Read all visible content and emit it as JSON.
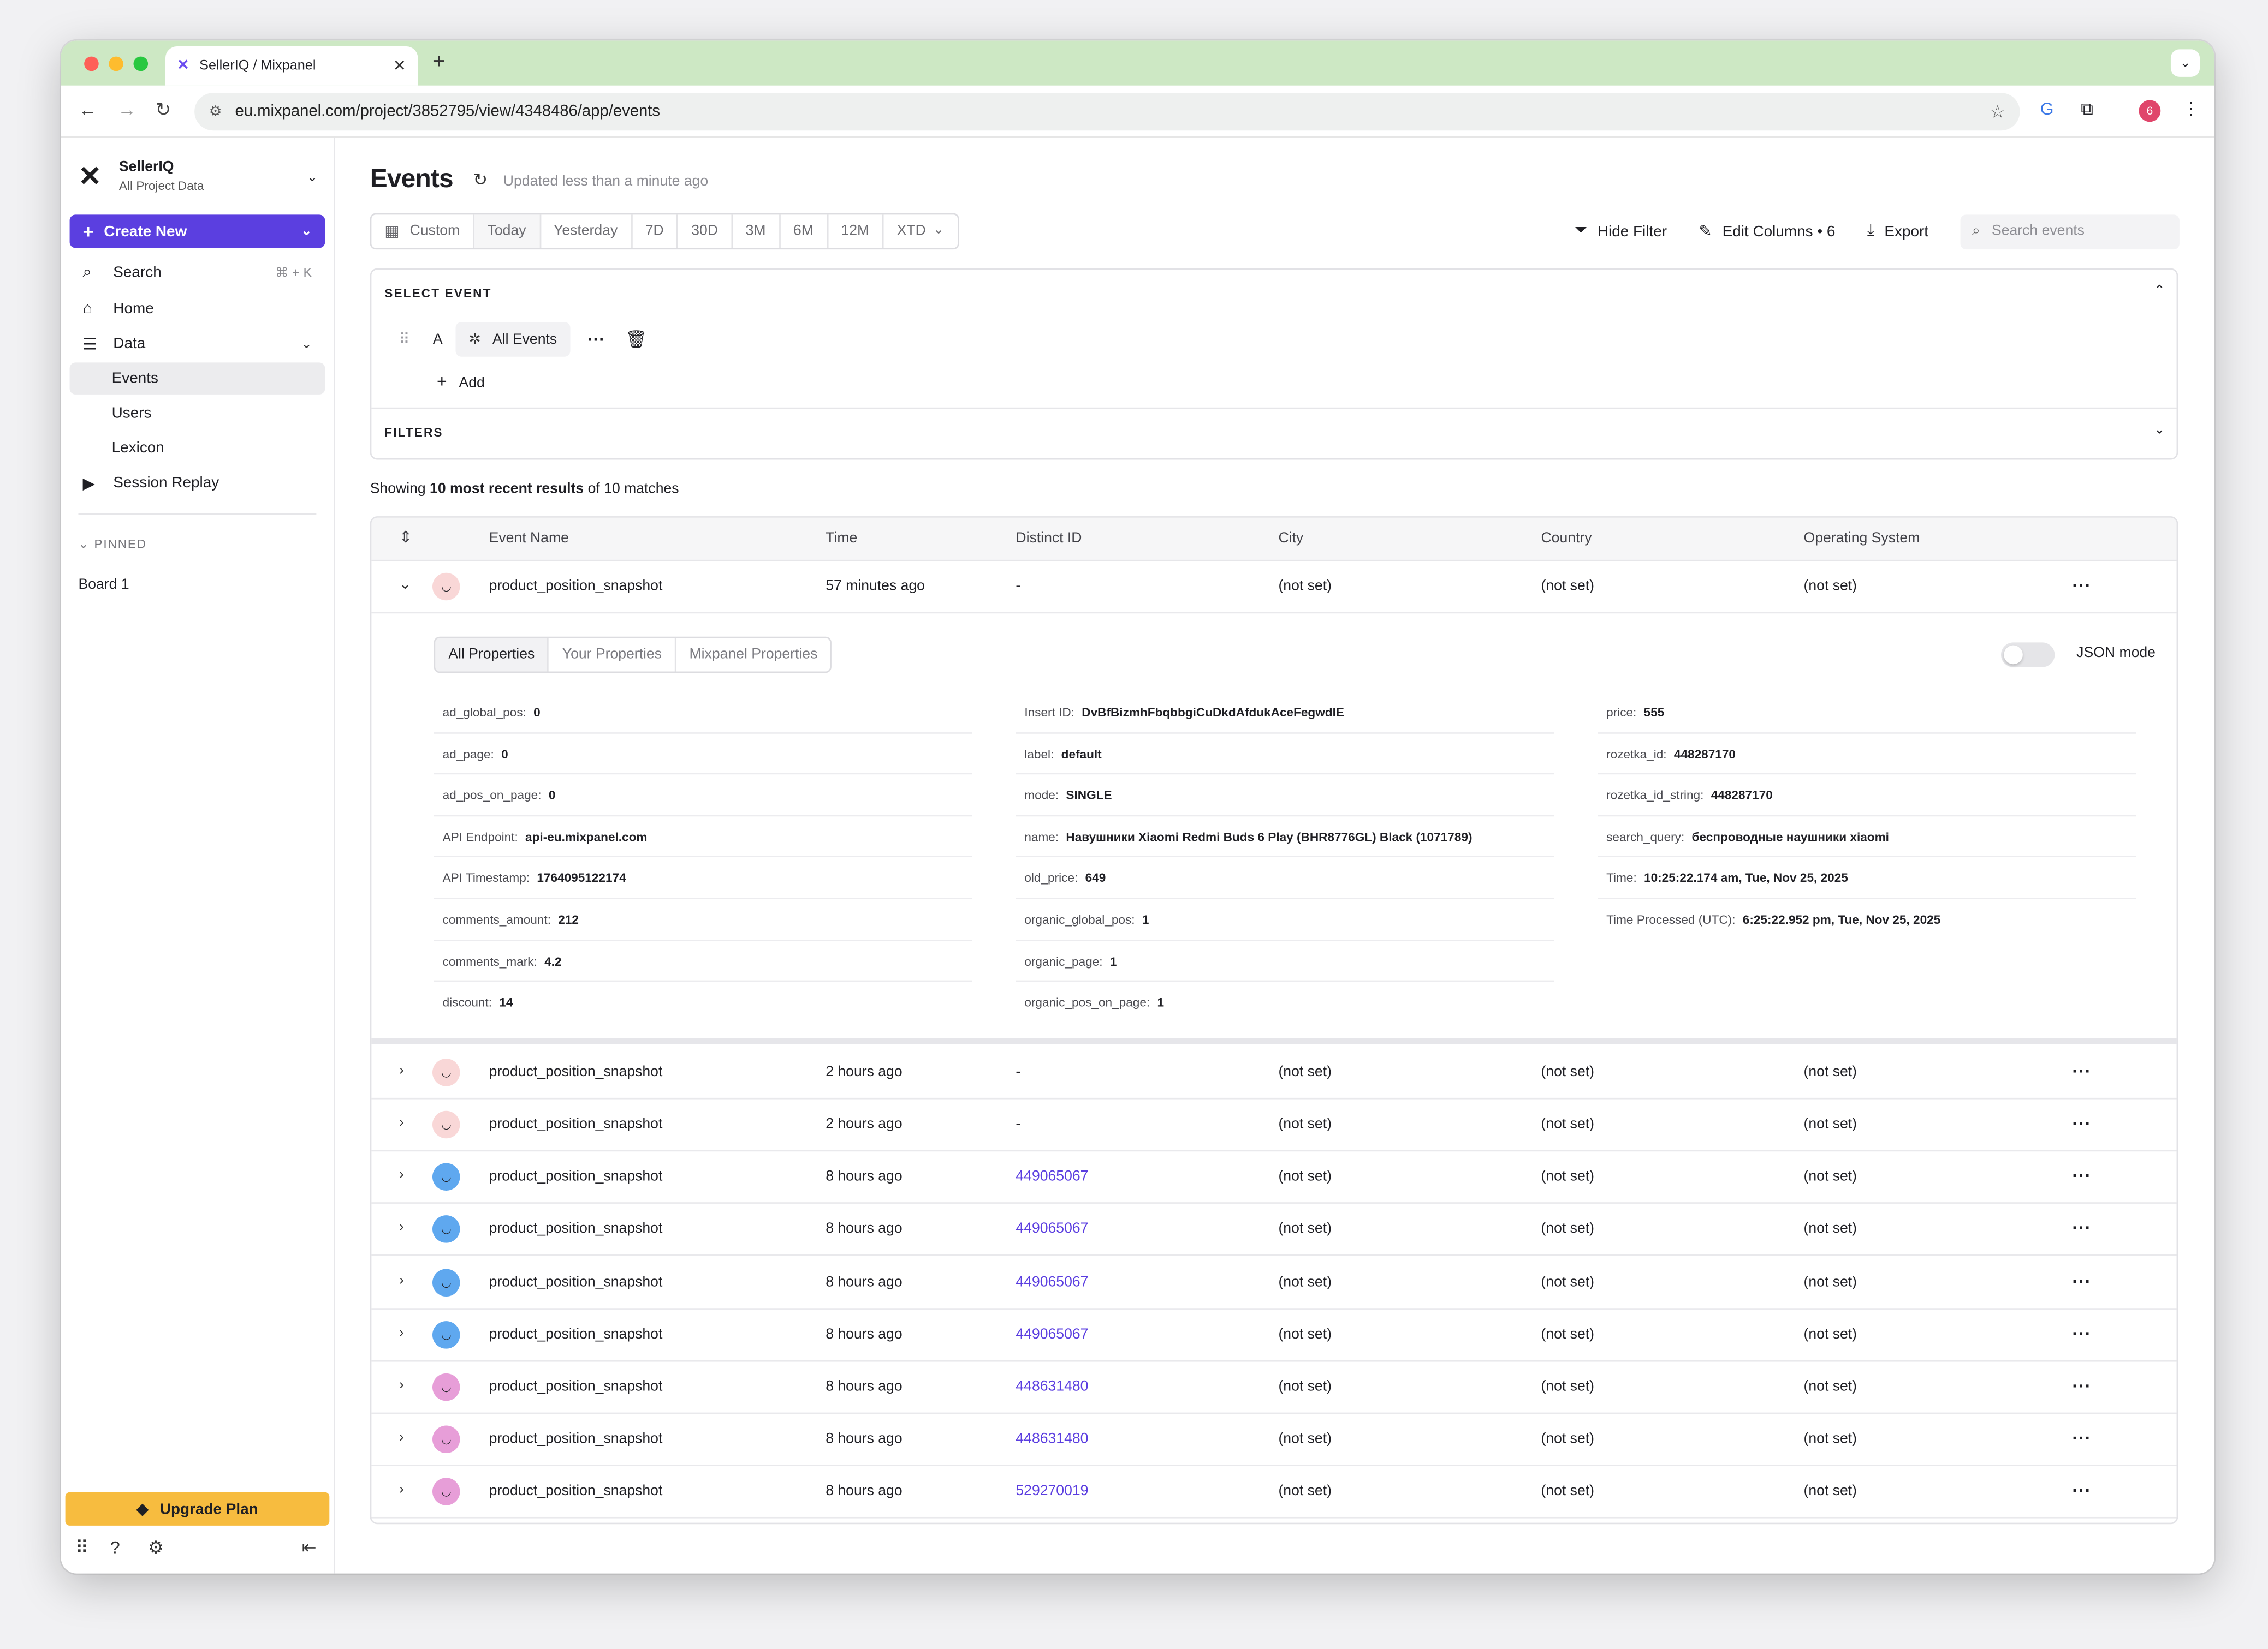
{
  "browser": {
    "tab_title": "SellerIQ / Mixpanel",
    "url": "eu.mixpanel.com/project/3852795/view/4348486/app/events",
    "profile_badge": "6"
  },
  "sidebar": {
    "workspace": {
      "name": "SellerIQ",
      "subtitle": "All Project Data"
    },
    "create_label": "Create New",
    "search": {
      "label": "Search",
      "shortcut": "⌘ + K"
    },
    "items": [
      {
        "label": "Home",
        "icon": "home-icon"
      },
      {
        "label": "Data",
        "icon": "database-icon"
      },
      {
        "label": "Events",
        "sub": true,
        "active": true
      },
      {
        "label": "Users",
        "sub": true
      },
      {
        "label": "Lexicon",
        "sub": true
      },
      {
        "label": "Session Replay",
        "icon": "replay-icon"
      }
    ],
    "pinned_label": "PINNED",
    "board_label": "Board 1",
    "upgrade_label": "Upgrade Plan"
  },
  "header": {
    "title": "Events",
    "updated": "Updated less than a minute ago"
  },
  "date_range": [
    "Custom",
    "Today",
    "Yesterday",
    "7D",
    "30D",
    "3M",
    "6M",
    "12M",
    "XTD"
  ],
  "date_range_active": "Today",
  "actions": {
    "hide_filter": "Hide Filter",
    "edit_columns": "Edit Columns • 6",
    "export": "Export",
    "search_placeholder": "Search events"
  },
  "select_event": {
    "heading": "SELECT EVENT",
    "letter": "A",
    "event": "All Events",
    "add": "Add",
    "filters_heading": "FILTERS"
  },
  "results": {
    "prefix": "Showing ",
    "bold": "10 most recent results",
    "suffix": " of 10 matches"
  },
  "table": {
    "columns": [
      "Event Name",
      "Time",
      "Distinct ID",
      "City",
      "Country",
      "Operating System"
    ],
    "rows": [
      {
        "event": "product_position_snapshot",
        "time": "57 minutes ago",
        "distinct_id": "-",
        "city": "(not set)",
        "country": "(not set)",
        "os": "(not set)",
        "avatar": "#f9d7d7"
      },
      {
        "event": "product_position_snapshot",
        "time": "2 hours ago",
        "distinct_id": "-",
        "city": "(not set)",
        "country": "(not set)",
        "os": "(not set)",
        "avatar": "#f9d7d7"
      },
      {
        "event": "product_position_snapshot",
        "time": "2 hours ago",
        "distinct_id": "-",
        "city": "(not set)",
        "country": "(not set)",
        "os": "(not set)",
        "avatar": "#f9d7d7"
      },
      {
        "event": "product_position_snapshot",
        "time": "8 hours ago",
        "distinct_id": "449065067",
        "city": "(not set)",
        "country": "(not set)",
        "os": "(not set)",
        "avatar": "#5fa8ef"
      },
      {
        "event": "product_position_snapshot",
        "time": "8 hours ago",
        "distinct_id": "449065067",
        "city": "(not set)",
        "country": "(not set)",
        "os": "(not set)",
        "avatar": "#5fa8ef"
      },
      {
        "event": "product_position_snapshot",
        "time": "8 hours ago",
        "distinct_id": "449065067",
        "city": "(not set)",
        "country": "(not set)",
        "os": "(not set)",
        "avatar": "#5fa8ef"
      },
      {
        "event": "product_position_snapshot",
        "time": "8 hours ago",
        "distinct_id": "449065067",
        "city": "(not set)",
        "country": "(not set)",
        "os": "(not set)",
        "avatar": "#5fa8ef"
      },
      {
        "event": "product_position_snapshot",
        "time": "8 hours ago",
        "distinct_id": "448631480",
        "city": "(not set)",
        "country": "(not set)",
        "os": "(not set)",
        "avatar": "#e79ed8"
      },
      {
        "event": "product_position_snapshot",
        "time": "8 hours ago",
        "distinct_id": "448631480",
        "city": "(not set)",
        "country": "(not set)",
        "os": "(not set)",
        "avatar": "#e79ed8"
      },
      {
        "event": "product_position_snapshot",
        "time": "8 hours ago",
        "distinct_id": "529270019",
        "city": "(not set)",
        "country": "(not set)",
        "os": "(not set)",
        "avatar": "#e79ed8"
      }
    ]
  },
  "expanded": {
    "tabs": [
      "All Properties",
      "Your Properties",
      "Mixpanel Properties"
    ],
    "json_mode": "JSON mode",
    "columns": [
      [
        {
          "k": "ad_global_pos:",
          "v": "0"
        },
        {
          "k": "ad_page:",
          "v": "0"
        },
        {
          "k": "ad_pos_on_page:",
          "v": "0"
        },
        {
          "k": "API Endpoint:",
          "v": "api-eu.mixpanel.com",
          "link": true
        },
        {
          "k": "API Timestamp:",
          "v": "1764095122174"
        },
        {
          "k": "comments_amount:",
          "v": "212"
        },
        {
          "k": "comments_mark:",
          "v": "4.2"
        },
        {
          "k": "discount:",
          "v": "14"
        }
      ],
      [
        {
          "k": "Insert ID:",
          "v": "DvBfBizmhFbqbbgiCuDkdAfdukAceFegwdIE"
        },
        {
          "k": "label:",
          "v": "default"
        },
        {
          "k": "mode:",
          "v": "SINGLE"
        },
        {
          "k": "name:",
          "v": "Навушники Xiaomi Redmi Buds 6 Play (BHR8776GL) Black (1071789)"
        },
        {
          "k": "old_price:",
          "v": "649"
        },
        {
          "k": "organic_global_pos:",
          "v": "1"
        },
        {
          "k": "organic_page:",
          "v": "1"
        },
        {
          "k": "organic_pos_on_page:",
          "v": "1"
        }
      ],
      [
        {
          "k": "price:",
          "v": "555"
        },
        {
          "k": "rozetka_id:",
          "v": "448287170"
        },
        {
          "k": "rozetka_id_string:",
          "v": "448287170"
        },
        {
          "k": "search_query:",
          "v": "беспроводные наушники xiaomi"
        },
        {
          "k": "Time:",
          "v": "10:25:22.174 am, Tue, Nov 25, 2025"
        },
        {
          "k": "Time Processed (UTC):",
          "v": "6:25:22.952 pm, Tue, Nov 25, 2025"
        }
      ]
    ]
  }
}
